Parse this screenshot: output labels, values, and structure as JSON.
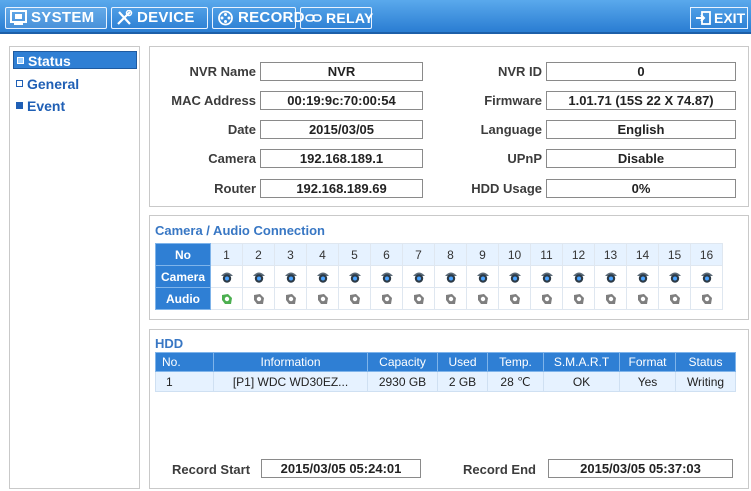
{
  "topbar": {
    "tabs": [
      {
        "label": "SYSTEM",
        "icon": "monitor-icon"
      },
      {
        "label": "DEVICE",
        "icon": "tools-icon"
      },
      {
        "label": "RECORD",
        "icon": "record-icon"
      },
      {
        "label": "RELAY",
        "icon": "relay-icon"
      }
    ],
    "exit_label": "EXIT"
  },
  "sidebar": {
    "items": [
      {
        "label": "Status"
      },
      {
        "label": "General"
      },
      {
        "label": "Event"
      }
    ]
  },
  "info": {
    "nvr_name_label": "NVR Name",
    "nvr_name": "NVR",
    "mac_label": "MAC Address",
    "mac": "00:19:9c:70:00:54",
    "date_label": "Date",
    "date": "2015/03/05",
    "camera_label": "Camera",
    "camera": "192.168.189.1",
    "router_label": "Router",
    "router": "192.168.189.69",
    "nvr_id_label": "NVR ID",
    "nvr_id": "0",
    "firmware_label": "Firmware",
    "firmware": "1.01.71 (15S 22 X 74.87)",
    "language_label": "Language",
    "language": "English",
    "upnp_label": "UPnP",
    "upnp": "Disable",
    "hdd_usage_label": "HDD Usage",
    "hdd_usage": "0%"
  },
  "connection": {
    "title": "Camera / Audio Connection",
    "row_no": "No",
    "row_camera": "Camera",
    "row_audio": "Audio",
    "channels": [
      "1",
      "2",
      "3",
      "4",
      "5",
      "6",
      "7",
      "8",
      "9",
      "10",
      "11",
      "12",
      "13",
      "14",
      "15",
      "16"
    ],
    "audio_active_channel": "1",
    "colors": {
      "header": "#2f7fd4",
      "audio_active": "#4caf50",
      "inactive": "#7f7f7f"
    }
  },
  "hdd": {
    "title": "HDD",
    "columns": [
      "No.",
      "Information",
      "Capacity",
      "Used",
      "Temp.",
      "S.M.A.R.T",
      "Format",
      "Status"
    ],
    "rows": [
      [
        "1",
        "[P1] WDC WD30EZ...",
        "2930 GB",
        "2 GB",
        "28 ℃",
        "OK",
        "Yes",
        "Writing"
      ]
    ],
    "record_start_label": "Record Start",
    "record_start": "2015/03/05 05:24:01",
    "record_end_label": "Record End",
    "record_end": "2015/03/05 05:37:03"
  }
}
